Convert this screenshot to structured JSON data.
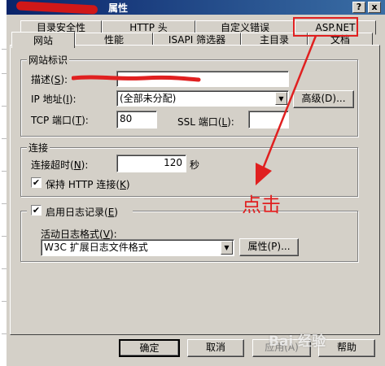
{
  "window": {
    "title": "属性",
    "help_btn": "?",
    "close_btn": "x"
  },
  "tabs_row1": [
    "目录安全性",
    "HTTP 头",
    "自定义错误",
    "ASP.NET"
  ],
  "tabs_row2": [
    "网站",
    "性能",
    "ISAPI 筛选器",
    "主目录",
    "文档"
  ],
  "site_id": {
    "legend": "网站标识",
    "desc_label": "描述(",
    "desc_key": "S",
    "desc_suffix": "):",
    "ip_label": "IP 地址(",
    "ip_key": "I",
    "ip_suffix": "):",
    "ip_value": "(全部未分配)",
    "advanced_btn": "高级(D)...",
    "tcp_label": "TCP 端口(",
    "tcp_key": "T",
    "tcp_suffix": "):",
    "tcp_value": "80",
    "ssl_label": "SSL 端口(",
    "ssl_key": "L",
    "ssl_suffix": "):",
    "ssl_value": ""
  },
  "connection": {
    "legend": "连接",
    "timeout_label": "连接超时(",
    "timeout_key": "N",
    "timeout_suffix": "):",
    "timeout_value": "120",
    "timeout_unit": "秒",
    "keepalive_label": "保持 HTTP 连接(",
    "keepalive_key": "K",
    "keepalive_suffix": ")",
    "keepalive_checked": true
  },
  "logging": {
    "enable_label": "启用日志记录(",
    "enable_key": "E",
    "enable_suffix": ")",
    "enable_checked": true,
    "format_label": "活动日志格式(",
    "format_key": "V",
    "format_suffix": "):",
    "format_value": "W3C 扩展日志文件格式",
    "props_btn": "属性(P)..."
  },
  "annotation": {
    "click_text": "点击",
    "color": "#e02020"
  },
  "footer": {
    "ok": "确定",
    "cancel": "取消",
    "apply": "应用(A)",
    "help": "帮助"
  },
  "watermark": "Bai 经验"
}
